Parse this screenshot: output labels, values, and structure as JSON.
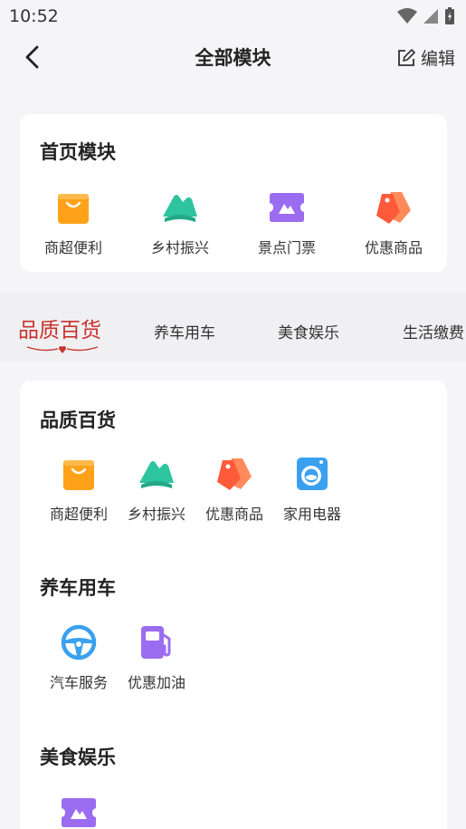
{
  "status_bar": {
    "time": "10:52"
  },
  "header": {
    "title": "全部模块",
    "edit_label": "编辑"
  },
  "home_module": {
    "title": "首页模块",
    "items": [
      {
        "label": "商超便利",
        "icon": "shopping-bag-icon",
        "color": "#ffa21a"
      },
      {
        "label": "乡村振兴",
        "icon": "mountain-icon",
        "color": "#2ec4a0"
      },
      {
        "label": "景点门票",
        "icon": "ticket-icon",
        "color": "#9b6cf0"
      },
      {
        "label": "优惠商品",
        "icon": "price-tag-icon",
        "color": "#ff6a3d"
      }
    ]
  },
  "tabs": [
    {
      "label": "品质百货",
      "active": true
    },
    {
      "label": "养车用车",
      "active": false
    },
    {
      "label": "美食娱乐",
      "active": false
    },
    {
      "label": "生活缴费",
      "active": false
    }
  ],
  "sections": [
    {
      "title": "品质百货",
      "items": [
        {
          "label": "商超便利",
          "icon": "shopping-bag-icon"
        },
        {
          "label": "乡村振兴",
          "icon": "mountain-icon"
        },
        {
          "label": "优惠商品",
          "icon": "price-tag-icon"
        },
        {
          "label": "家用电器",
          "icon": "washing-machine-icon"
        }
      ]
    },
    {
      "title": "养车用车",
      "items": [
        {
          "label": "汽车服务",
          "icon": "steering-wheel-icon"
        },
        {
          "label": "优惠加油",
          "icon": "fuel-pump-icon"
        }
      ]
    },
    {
      "title": "美食娱乐",
      "items": [
        {
          "label": "",
          "icon": "ticket-icon"
        }
      ]
    }
  ],
  "colors": {
    "accent": "#c8322d",
    "background": "#f5f5f7"
  }
}
